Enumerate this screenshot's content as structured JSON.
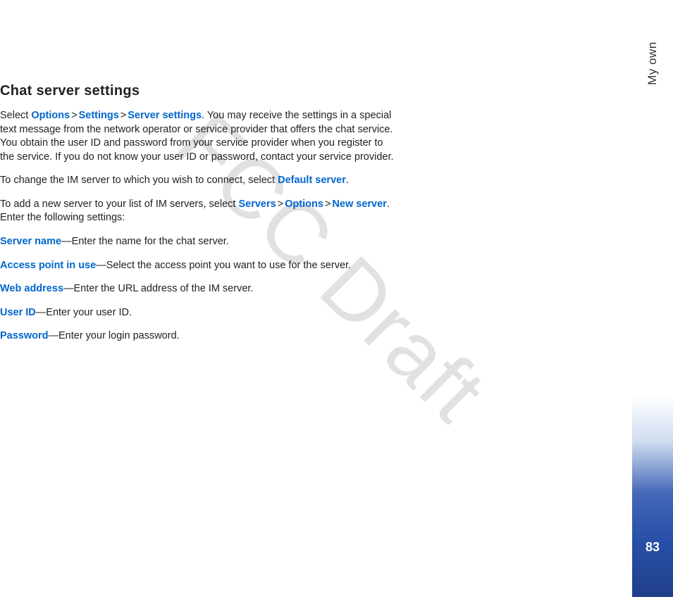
{
  "heading": "Chat server settings",
  "watermark": "FCC Draft",
  "sidebar": {
    "label": "My own",
    "page_number": "83"
  },
  "nav": {
    "options": "Options",
    "settings": "Settings",
    "server_settings": "Server settings",
    "default_server": "Default server",
    "servers": "Servers",
    "new_server": "New server",
    "server_name": "Server name",
    "access_point": "Access point in use",
    "web_address": "Web address",
    "user_id": "User ID",
    "password": "Password",
    "gt": ">"
  },
  "p1": {
    "pre": "Select ",
    "post": ". You may receive the settings in a special text message from the network operator or service provider that offers the chat service. You obtain the user ID and password from your service provider when you register to the service. If you do not know your user ID or password, contact your service provider."
  },
  "p2": {
    "pre": "To change the IM server to which you wish to connect, select ",
    "post": "."
  },
  "p3": {
    "pre": "To add a new server to your list of IM servers, select ",
    "post": ". Enter the following settings:"
  },
  "p4": "—Enter the name for the chat server.",
  "p5": "—Select the access point you want to use for the server.",
  "p6": "—Enter the URL address of the IM server.",
  "p7": "—Enter your user ID.",
  "p8": "—Enter your login password."
}
